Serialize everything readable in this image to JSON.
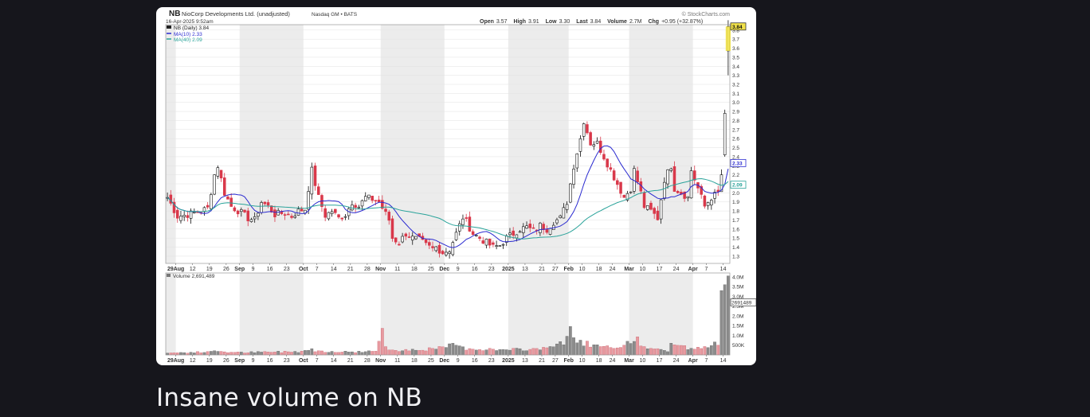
{
  "caption": "Insane volume on NB",
  "chart_data": {
    "type": "candlestick",
    "header": {
      "symbol": "NB",
      "company": "NioCorp Developments Ltd. (unadjusted)",
      "exchange": "Nasdaq GM • BATS",
      "date": "16-Apr-2025 9:52am",
      "watermark": "© StockCharts.com",
      "open_label": "Open",
      "open": "3.57",
      "high_label": "High",
      "high": "3.91",
      "low_label": "Low",
      "low": "3.30",
      "last_label": "Last",
      "last": "3.84",
      "volume_label": "Volume",
      "volume": "2.7M",
      "chg_label": "Chg",
      "chg": "+0.95 (+32.87%)"
    },
    "legend": {
      "price": "NB (Daily) 3.84",
      "ma10": "MA(10) 2.33",
      "ma40": "MA(40) 2.09",
      "volume": "Volume 2,691,489"
    },
    "price_axis": {
      "ylim": [
        1.22,
        3.86
      ],
      "ticks": [
        1.3,
        1.4,
        1.5,
        1.6,
        1.7,
        1.8,
        1.9,
        2.0,
        2.1,
        2.2,
        2.3,
        2.4,
        2.5,
        2.6,
        2.7,
        2.8,
        2.9,
        3.0,
        3.1,
        3.2,
        3.3,
        3.4,
        3.5,
        3.6,
        3.7,
        3.8
      ],
      "tick_labels": [
        "1.3",
        "1.4",
        "1.5",
        "1.6",
        "1.7",
        "1.8",
        "1.9",
        "2.0",
        "2.1",
        "2.2",
        "2.3",
        "2.4",
        "2.5",
        "2.6",
        "2.7",
        "2.8",
        "2.9",
        "3.0",
        "3.1",
        "3.2",
        "3.3",
        "3.4",
        "3.5",
        "3.6",
        "3.7",
        "3.8"
      ],
      "last_marker": "3.84",
      "ma10_marker": "2.33",
      "ma40_marker": "2.09"
    },
    "volume_axis": {
      "ylim": [
        0,
        4200000
      ],
      "ticks": [
        500000,
        1000000,
        1500000,
        2000000,
        2500000,
        3000000,
        3500000,
        4000000
      ],
      "tick_labels": [
        "500K",
        "1.0M",
        "1.5M",
        "2.0M",
        "2.5M",
        "3.0M",
        "3.5M",
        "4.0M"
      ],
      "last_marker": "2691489"
    },
    "x_ticks": [
      {
        "i": 3,
        "label": "29Aug",
        "major": true
      },
      {
        "i": 8,
        "label": "12"
      },
      {
        "i": 13,
        "label": "19"
      },
      {
        "i": 18,
        "label": "26"
      },
      {
        "i": 22,
        "label": "Sep",
        "major": true
      },
      {
        "i": 26,
        "label": "9"
      },
      {
        "i": 31,
        "label": "16"
      },
      {
        "i": 36,
        "label": "23"
      },
      {
        "i": 41,
        "label": "Oct",
        "major": true
      },
      {
        "i": 45,
        "label": "7"
      },
      {
        "i": 50,
        "label": "14"
      },
      {
        "i": 55,
        "label": "21"
      },
      {
        "i": 60,
        "label": "28"
      },
      {
        "i": 64,
        "label": "Nov",
        "major": true
      },
      {
        "i": 69,
        "label": "11"
      },
      {
        "i": 74,
        "label": "18"
      },
      {
        "i": 79,
        "label": "25"
      },
      {
        "i": 83,
        "label": "Dec",
        "major": true
      },
      {
        "i": 87,
        "label": "9"
      },
      {
        "i": 92,
        "label": "16"
      },
      {
        "i": 97,
        "label": "23"
      },
      {
        "i": 102,
        "label": "2025",
        "major": true
      },
      {
        "i": 107,
        "label": "13"
      },
      {
        "i": 112,
        "label": "21"
      },
      {
        "i": 116,
        "label": "27"
      },
      {
        "i": 120,
        "label": "Feb",
        "major": true
      },
      {
        "i": 124,
        "label": "10"
      },
      {
        "i": 129,
        "label": "18"
      },
      {
        "i": 133,
        "label": "24"
      },
      {
        "i": 138,
        "label": "Mar",
        "major": true
      },
      {
        "i": 142,
        "label": "10"
      },
      {
        "i": 147,
        "label": "17"
      },
      {
        "i": 152,
        "label": "24"
      },
      {
        "i": 157,
        "label": "Apr",
        "major": true
      },
      {
        "i": 161,
        "label": "7"
      },
      {
        "i": 166,
        "label": "14"
      }
    ],
    "shade_bands": [
      [
        0,
        3
      ],
      [
        22,
        41
      ],
      [
        64,
        83
      ],
      [
        102,
        120
      ],
      [
        138,
        157
      ]
    ],
    "anchors": [
      [
        0,
        1.95
      ],
      [
        3,
        1.74
      ],
      [
        6,
        1.76
      ],
      [
        10,
        1.8
      ],
      [
        12,
        1.83
      ],
      [
        14,
        2.2
      ],
      [
        15,
        2.3
      ],
      [
        17,
        2.0
      ],
      [
        19,
        1.85
      ],
      [
        22,
        1.78
      ],
      [
        24,
        1.72
      ],
      [
        26,
        1.7
      ],
      [
        28,
        1.9
      ],
      [
        30,
        1.85
      ],
      [
        32,
        1.76
      ],
      [
        35,
        1.78
      ],
      [
        37,
        1.74
      ],
      [
        39,
        1.8
      ],
      [
        41,
        1.82
      ],
      [
        42,
        2.05
      ],
      [
        43,
        2.25
      ],
      [
        45,
        1.95
      ],
      [
        47,
        1.75
      ],
      [
        49,
        1.8
      ],
      [
        51,
        1.72
      ],
      [
        53,
        1.76
      ],
      [
        55,
        1.9
      ],
      [
        57,
        1.85
      ],
      [
        59,
        1.95
      ],
      [
        61,
        1.93
      ],
      [
        63,
        1.9
      ],
      [
        66,
        1.7
      ],
      [
        67,
        1.5
      ],
      [
        69,
        1.45
      ],
      [
        71,
        1.55
      ],
      [
        73,
        1.5
      ],
      [
        75,
        1.48
      ],
      [
        77,
        1.42
      ],
      [
        79,
        1.38
      ],
      [
        80,
        1.4
      ],
      [
        82,
        1.34
      ],
      [
        84,
        1.37
      ],
      [
        86,
        1.55
      ],
      [
        88,
        1.73
      ],
      [
        89,
        1.68
      ],
      [
        91,
        1.55
      ],
      [
        93,
        1.5
      ],
      [
        95,
        1.45
      ],
      [
        97,
        1.4
      ],
      [
        99,
        1.42
      ],
      [
        101,
        1.5
      ],
      [
        103,
        1.55
      ],
      [
        105,
        1.6
      ],
      [
        107,
        1.62
      ],
      [
        109,
        1.58
      ],
      [
        111,
        1.64
      ],
      [
        113,
        1.6
      ],
      [
        115,
        1.68
      ],
      [
        117,
        1.72
      ],
      [
        119,
        1.9
      ],
      [
        121,
        2.3
      ],
      [
        123,
        2.6
      ],
      [
        124,
        2.8
      ],
      [
        126,
        2.55
      ],
      [
        128,
        2.55
      ],
      [
        130,
        2.4
      ],
      [
        132,
        2.25
      ],
      [
        134,
        2.1
      ],
      [
        136,
        1.95
      ],
      [
        138,
        2.05
      ],
      [
        139,
        2.25
      ],
      [
        141,
        2.0
      ],
      [
        142,
        1.85
      ],
      [
        144,
        1.8
      ],
      [
        146,
        1.72
      ],
      [
        148,
        2.15
      ],
      [
        150,
        2.3
      ],
      [
        151,
        2.05
      ],
      [
        153,
        2.0
      ],
      [
        155,
        1.95
      ],
      [
        156,
        2.25
      ],
      [
        158,
        2.05
      ],
      [
        160,
        1.85
      ],
      [
        162,
        1.95
      ],
      [
        164,
        2.0
      ],
      [
        165,
        2.2
      ],
      [
        166,
        2.9
      ],
      [
        167,
        3.84
      ]
    ],
    "volume_anchors": [
      [
        0,
        0.1
      ],
      [
        13,
        0.15
      ],
      [
        14,
        0.22
      ],
      [
        20,
        0.12
      ],
      [
        31,
        0.15
      ],
      [
        40,
        0.18
      ],
      [
        42,
        0.3
      ],
      [
        45,
        0.2
      ],
      [
        55,
        0.15
      ],
      [
        62,
        0.2
      ],
      [
        63,
        0.55
      ],
      [
        64,
        1.55
      ],
      [
        65,
        0.35
      ],
      [
        68,
        0.25
      ],
      [
        80,
        0.3
      ],
      [
        84,
        0.45
      ],
      [
        86,
        0.55
      ],
      [
        88,
        0.35
      ],
      [
        94,
        0.3
      ],
      [
        100,
        0.25
      ],
      [
        110,
        0.3
      ],
      [
        115,
        0.5
      ],
      [
        118,
        0.55
      ],
      [
        120,
        1.45
      ],
      [
        121,
        0.75
      ],
      [
        124,
        0.65
      ],
      [
        127,
        0.45
      ],
      [
        135,
        0.3
      ],
      [
        139,
        0.8
      ],
      [
        140,
        1.1
      ],
      [
        141,
        0.55
      ],
      [
        142,
        0.4
      ],
      [
        149,
        0.2
      ],
      [
        150,
        0.6
      ],
      [
        153,
        0.45
      ],
      [
        156,
        0.3
      ],
      [
        160,
        0.35
      ],
      [
        163,
        0.55
      ],
      [
        164,
        0.6
      ],
      [
        165,
        3.3
      ],
      [
        166,
        3.6
      ],
      [
        167,
        4.05
      ]
    ]
  },
  "colors": {
    "up": "#111111",
    "down": "#d9384a",
    "ma10": "#2a2ad0",
    "ma40": "#2aa39a",
    "shade": "#ececec",
    "volume_up": "#8c8c8c",
    "volume_down": "#e89aa0",
    "highlight": "#f1e24a"
  }
}
